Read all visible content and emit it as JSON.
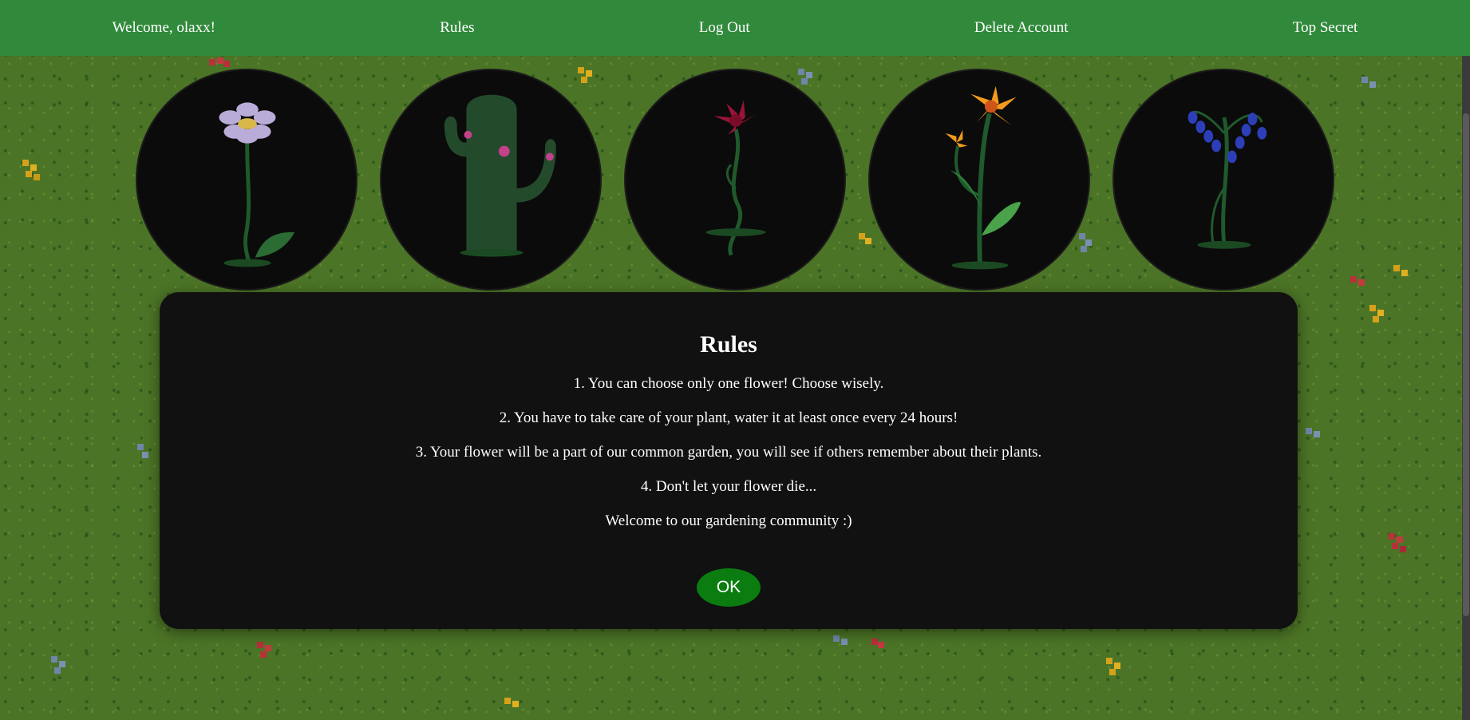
{
  "nav": {
    "welcome": "Welcome, olaxx!",
    "rules": "Rules",
    "logout": "Log Out",
    "delete_account": "Delete Account",
    "top_secret": "Top Secret"
  },
  "flowers": [
    {
      "name": "daisy-flower",
      "petal_color": "#c7b8e6"
    },
    {
      "name": "cactus-plant",
      "petal_color": "#d43b8c"
    },
    {
      "name": "red-lily-flower",
      "petal_color": "#a0153a"
    },
    {
      "name": "orange-lily-flower",
      "petal_color": "#f39a1e"
    },
    {
      "name": "bluebell-flower",
      "petal_color": "#2c3fb8"
    }
  ],
  "modal": {
    "title": "Rules",
    "rules": [
      "1. You can choose only one flower! Choose wisely.",
      "2. You have to take care of your plant, water it at least once every 24 hours!",
      "3. Your flower will be a part of our common garden, you will see if others remember about their plants.",
      "4. Don't let your flower die...",
      "Welcome to our gardening community :)"
    ],
    "ok_label": "OK"
  },
  "colors": {
    "navbar": "#318a3b",
    "grass": "#4c7426",
    "modal_bg": "#111111",
    "ok_button": "#0b7d10"
  }
}
